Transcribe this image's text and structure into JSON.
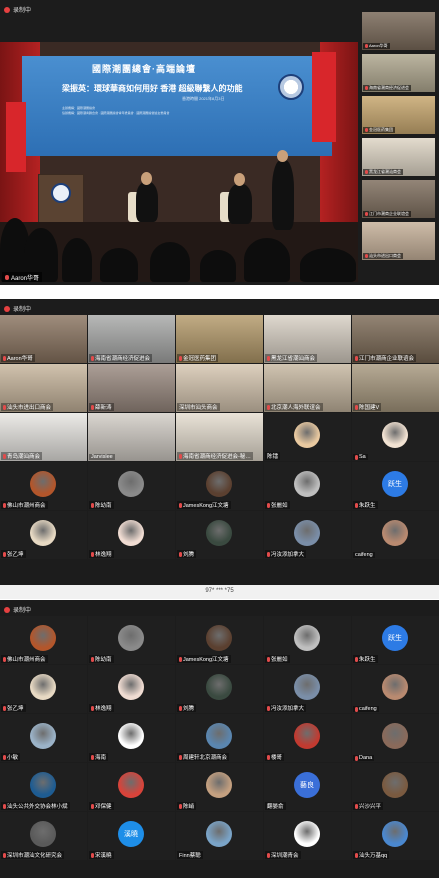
{
  "recording_label": "录制中",
  "meeting_number": "97* *** *75",
  "main_view": {
    "banner_title": "國際潮團總會·高端論壇",
    "banner_subtitle": "梁振英：環球華商如何用好 香港 超級聯繫人的功能",
    "banner_date": "香港時間 2021年8月3日",
    "banner_small_lines": [
      "主辦機構：國際潮團總會",
      "協辦機構：國際潮青聯合會 · 國際潮團總會青年委員會 · 國際潮團總會婦女委員會"
    ],
    "speaker_caption": "Aaron华哥"
  },
  "side_thumbnails": [
    {
      "label": "Aaron华哥",
      "muted": true
    },
    {
      "label": "海南省潮商经济促进会",
      "muted": true
    },
    {
      "label": "金冠医药集团",
      "muted": true
    },
    {
      "label": "黑龙江省潮汕商会",
      "muted": true
    },
    {
      "label": "江门市潮商企业联谊会",
      "muted": true
    },
    {
      "label": "汕头市进出口商会",
      "muted": true
    }
  ],
  "grid_page1": [
    {
      "name": "Aaron华哥",
      "mic": true,
      "type": "video",
      "color": "#8a7460"
    },
    {
      "name": "海南省潮商经济促进会",
      "mic": true,
      "type": "video",
      "color": "#a8a9a8"
    },
    {
      "name": "金冠医药集团",
      "mic": true,
      "type": "video",
      "color": "#b49a6a"
    },
    {
      "name": "黑龙江省潮汕商会",
      "mic": true,
      "type": "video",
      "color": "#d8d0c4"
    },
    {
      "name": "江门市潮商企业联谊会",
      "mic": true,
      "type": "video",
      "color": "#7c6a56"
    },
    {
      "name": "汕头市进出口商会",
      "mic": true,
      "type": "video",
      "color": "#c7b59c"
    },
    {
      "name": "薛新涛",
      "mic": true,
      "type": "video",
      "color": "#9a8a80"
    },
    {
      "name": "深圳市汕头商会",
      "mic": false,
      "type": "video",
      "color": "#d6c6b0"
    },
    {
      "name": "北京潮人海外联谊会",
      "mic": true,
      "type": "video",
      "color": "#c6b7a0"
    },
    {
      "name": "陈国建V",
      "mic": true,
      "type": "video",
      "color": "#a7987e"
    },
    {
      "name": "青岛潮汕商会",
      "mic": true,
      "type": "video",
      "color": "#e8e6e2"
    },
    {
      "name": "Jarvislee",
      "mic": false,
      "type": "video",
      "color": "#d2cdc6"
    },
    {
      "name": "海南省潮商经济促进会-秘…",
      "mic": true,
      "type": "video",
      "color": "#e5ddcf"
    },
    {
      "name": "陈镭",
      "mic": false,
      "type": "avatar",
      "color": "#e9c9a0"
    },
    {
      "name": "Sa",
      "mic": true,
      "type": "avatar",
      "color": "#f2e2d2"
    },
    {
      "name": "佛山市潮州商会",
      "mic": true,
      "type": "avatar",
      "color": "#b3562b"
    },
    {
      "name": "陈幼南",
      "mic": true,
      "type": "avatar",
      "color": "#8a8a8a"
    },
    {
      "name": "JamesKong江文塘",
      "mic": true,
      "type": "avatar",
      "color": "#5b4030"
    },
    {
      "name": "张麗如",
      "mic": true,
      "type": "avatar",
      "color": "#bfbfbf"
    },
    {
      "name": "朱跃生",
      "mic": true,
      "type": "text",
      "color": "#2d7be5",
      "text": "跃生"
    },
    {
      "name": "张乙坤",
      "mic": true,
      "type": "avatar",
      "color": "#e7d9c3"
    },
    {
      "name": "林逸翔",
      "mic": true,
      "type": "avatar",
      "color": "#f0dcd2"
    },
    {
      "name": "刘腾",
      "mic": true,
      "type": "avatar",
      "color": "#3a4a40"
    },
    {
      "name": "冯汝添加拿大",
      "mic": true,
      "type": "avatar",
      "color": "#7a8ea8"
    },
    {
      "name": "caifeng",
      "mic": false,
      "type": "avatar",
      "color": "#b98a70"
    }
  ],
  "grid_page2": [
    {
      "name": "佛山市潮州商会",
      "mic": true,
      "type": "avatar",
      "color": "#b3562b"
    },
    {
      "name": "陈幼南",
      "mic": true,
      "type": "avatar",
      "color": "#8a8a8a"
    },
    {
      "name": "JamesKong江文塘",
      "mic": true,
      "type": "avatar",
      "color": "#5b4030"
    },
    {
      "name": "张麗如",
      "mic": true,
      "type": "avatar",
      "color": "#bfbfbf"
    },
    {
      "name": "朱跃生",
      "mic": true,
      "type": "text",
      "color": "#2d7be5",
      "text": "跃生"
    },
    {
      "name": "张乙坤",
      "mic": true,
      "type": "avatar",
      "color": "#e7d9c3"
    },
    {
      "name": "林逸翔",
      "mic": true,
      "type": "avatar",
      "color": "#f0dcd2"
    },
    {
      "name": "刘腾",
      "mic": true,
      "type": "avatar",
      "color": "#3a4a40"
    },
    {
      "name": "冯汝添加拿大",
      "mic": true,
      "type": "avatar",
      "color": "#7a8ea8"
    },
    {
      "name": "caifeng",
      "mic": true,
      "type": "avatar",
      "color": "#b98a70"
    },
    {
      "name": "小敏",
      "mic": true,
      "type": "avatar",
      "color": "#9bb3c8"
    },
    {
      "name": "海南",
      "mic": true,
      "type": "avatar",
      "color": "#ffffff"
    },
    {
      "name": "周建轩北京潮商会",
      "mic": true,
      "type": "avatar",
      "color": "#5a86b0"
    },
    {
      "name": "楼哥",
      "mic": true,
      "type": "avatar",
      "color": "#c23a30"
    },
    {
      "name": "Dana",
      "mic": true,
      "type": "avatar",
      "color": "#8a6a5a"
    },
    {
      "name": "汕头公共外交协会林小斌",
      "mic": true,
      "type": "avatar",
      "color": "#1e5c92"
    },
    {
      "name": "邓保健",
      "mic": true,
      "type": "avatar",
      "color": "#d8433a"
    },
    {
      "name": "陈峭",
      "mic": true,
      "type": "avatar",
      "color": "#c4a080"
    },
    {
      "name": "翻晏俞",
      "mic": false,
      "type": "text",
      "color": "#3a6fd8",
      "text": "藝良"
    },
    {
      "name": "兴沙兴平",
      "mic": true,
      "type": "avatar",
      "color": "#7a5a40"
    },
    {
      "name": "深圳市潮汕文化研究会",
      "mic": true,
      "type": "avatar",
      "color": "#5a5a5a"
    },
    {
      "name": "宋溪曉",
      "mic": true,
      "type": "text",
      "color": "#1e8ee8",
      "text": "溪曉"
    },
    {
      "name": "Finn蔡聪",
      "mic": false,
      "type": "avatar",
      "color": "#7aa4c8"
    },
    {
      "name": "深圳潮青会",
      "mic": true,
      "type": "avatar",
      "color": "#ffffff"
    },
    {
      "name": "汕头万基qq",
      "mic": true,
      "type": "avatar",
      "color": "#4a88d0"
    }
  ],
  "colors": {
    "background": "#1c1c1c",
    "divider": "#f1f1f1",
    "recording": "#e64141",
    "muted_mic": "#e24b4b"
  }
}
